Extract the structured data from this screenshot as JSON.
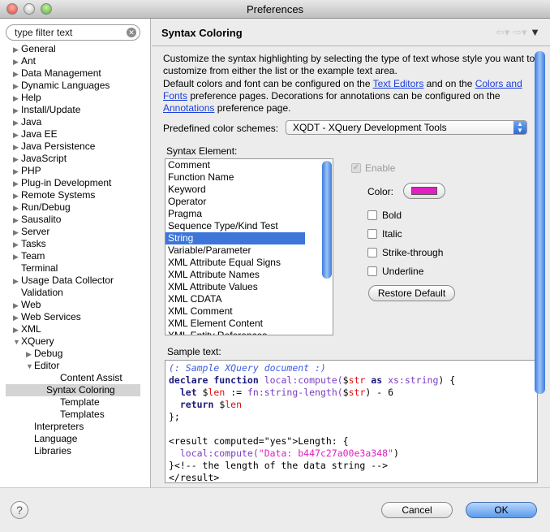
{
  "window": {
    "title": "Preferences"
  },
  "filter": {
    "placeholder": "type filter text"
  },
  "tree": [
    {
      "label": "General",
      "level": 0,
      "arrow": "right"
    },
    {
      "label": "Ant",
      "level": 0,
      "arrow": "right"
    },
    {
      "label": "Data Management",
      "level": 0,
      "arrow": "right"
    },
    {
      "label": "Dynamic Languages",
      "level": 0,
      "arrow": "right"
    },
    {
      "label": "Help",
      "level": 0,
      "arrow": "right"
    },
    {
      "label": "Install/Update",
      "level": 0,
      "arrow": "right"
    },
    {
      "label": "Java",
      "level": 0,
      "arrow": "right"
    },
    {
      "label": "Java EE",
      "level": 0,
      "arrow": "right"
    },
    {
      "label": "Java Persistence",
      "level": 0,
      "arrow": "right"
    },
    {
      "label": "JavaScript",
      "level": 0,
      "arrow": "right"
    },
    {
      "label": "PHP",
      "level": 0,
      "arrow": "right"
    },
    {
      "label": "Plug-in Development",
      "level": 0,
      "arrow": "right"
    },
    {
      "label": "Remote Systems",
      "level": 0,
      "arrow": "right"
    },
    {
      "label": "Run/Debug",
      "level": 0,
      "arrow": "right"
    },
    {
      "label": "Sausalito",
      "level": 0,
      "arrow": "right"
    },
    {
      "label": "Server",
      "level": 0,
      "arrow": "right"
    },
    {
      "label": "Tasks",
      "level": 0,
      "arrow": "right"
    },
    {
      "label": "Team",
      "level": 0,
      "arrow": "right"
    },
    {
      "label": "Terminal",
      "level": 0,
      "arrow": ""
    },
    {
      "label": "Usage Data Collector",
      "level": 0,
      "arrow": "right"
    },
    {
      "label": "Validation",
      "level": 0,
      "arrow": ""
    },
    {
      "label": "Web",
      "level": 0,
      "arrow": "right"
    },
    {
      "label": "Web Services",
      "level": 0,
      "arrow": "right"
    },
    {
      "label": "XML",
      "level": 0,
      "arrow": "right"
    },
    {
      "label": "XQuery",
      "level": 0,
      "arrow": "down"
    },
    {
      "label": "Debug",
      "level": 1,
      "arrow": "right"
    },
    {
      "label": "Editor",
      "level": 1,
      "arrow": "down"
    },
    {
      "label": "Content Assist",
      "level": 2,
      "arrow": ""
    },
    {
      "label": "Syntax Coloring",
      "level": 2,
      "arrow": "",
      "selected": true
    },
    {
      "label": "Template",
      "level": 2,
      "arrow": ""
    },
    {
      "label": "Templates",
      "level": 2,
      "arrow": ""
    },
    {
      "label": "Interpreters",
      "level": 1,
      "arrow": ""
    },
    {
      "label": "Language",
      "level": 1,
      "arrow": ""
    },
    {
      "label": "Libraries",
      "level": 1,
      "arrow": ""
    }
  ],
  "page": {
    "title": "Syntax Coloring",
    "intro": "Customize the syntax highlighting by selecting the type of text whose style you want to customize from either the list or the example text area.",
    "defaults": {
      "t1": "Default colors and font can be configured on the ",
      "link1": "Text Editors",
      "t2": " and on the ",
      "link2": "Colors and Fonts",
      "t3": " preference pages.  Decorations for annotations can be configured on the ",
      "link3": "Annotations",
      "t4": " preference page."
    },
    "scheme_label": "Predefined color schemes:",
    "scheme_value": "XQDT - XQuery Development Tools",
    "element_label": "Syntax Element:",
    "elements": [
      "Comment",
      "Function Name",
      "Keyword",
      "Operator",
      "Pragma",
      "Sequence Type/Kind Test",
      "String",
      "Variable/Parameter",
      "XML Attribute Equal Signs",
      "XML Attribute Names",
      "XML Attribute Values",
      "XML CDATA",
      "XML Comment",
      "XML Element Content",
      "XML Entity References"
    ],
    "selected_element": "String",
    "enable": {
      "label": "Enable",
      "checked": true,
      "disabled": true
    },
    "color_label": "Color:",
    "color_value": "#e020c0",
    "bold": {
      "label": "Bold",
      "checked": false
    },
    "italic": {
      "label": "Italic",
      "checked": false
    },
    "strike": {
      "label": "Strike-through",
      "checked": false
    },
    "underline": {
      "label": "Underline",
      "checked": false
    },
    "restore": "Restore Default",
    "sample_label": "Sample text:",
    "code": [
      [
        [
          "(: Sample XQuery document :)",
          "comment"
        ]
      ],
      [
        [
          "declare function ",
          "kw"
        ],
        [
          "local:compute(",
          "fn"
        ],
        [
          "$",
          "txt"
        ],
        [
          "str",
          "var"
        ],
        [
          " as ",
          "kw"
        ],
        [
          "xs:string",
          "fn"
        ],
        [
          ") {",
          "txt"
        ]
      ],
      [
        [
          "  let ",
          "kw"
        ],
        [
          "$",
          "txt"
        ],
        [
          "len",
          "var"
        ],
        [
          " := ",
          "txt"
        ],
        [
          "fn:string-length(",
          "fn"
        ],
        [
          "$",
          "txt"
        ],
        [
          "str",
          "var"
        ],
        [
          ") - 6",
          "txt"
        ]
      ],
      [
        [
          "  return ",
          "kw"
        ],
        [
          "$",
          "txt"
        ],
        [
          "len",
          "var"
        ]
      ],
      [
        [
          "};",
          "txt"
        ]
      ],
      [
        [
          "",
          "txt"
        ]
      ],
      [
        [
          "<result computed=\"yes\">Length: {",
          "txt"
        ]
      ],
      [
        [
          "  local:compute(",
          "fn"
        ],
        [
          "\"Data: b447c27a00e3a348\"",
          "str"
        ],
        [
          ")",
          "txt"
        ]
      ],
      [
        [
          "}<!-- the length of the data string -->",
          "txt"
        ]
      ],
      [
        [
          "</result>",
          "txt"
        ]
      ]
    ]
  },
  "buttons": {
    "help": "?",
    "cancel": "Cancel",
    "ok": "OK"
  }
}
